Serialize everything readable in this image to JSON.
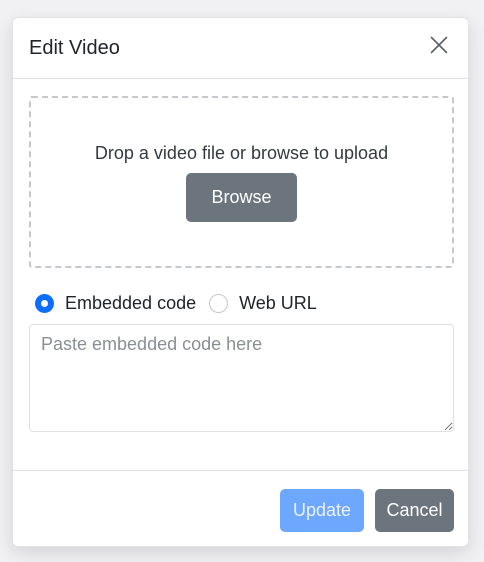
{
  "modal": {
    "title": "Edit Video",
    "close_icon": "close-icon"
  },
  "dropzone": {
    "text": "Drop a video file or browse to upload",
    "browse_label": "Browse"
  },
  "source_options": [
    {
      "label": "Embedded code",
      "checked": true
    },
    {
      "label": "Web URL",
      "checked": false
    }
  ],
  "embed": {
    "value": "",
    "placeholder": "Paste embedded code here"
  },
  "footer": {
    "update_label": "Update",
    "update_disabled": true,
    "cancel_label": "Cancel"
  },
  "colors": {
    "primary": "#0d6efd",
    "primary_disabled": "#6ea8fe",
    "secondary": "#6c757d"
  }
}
